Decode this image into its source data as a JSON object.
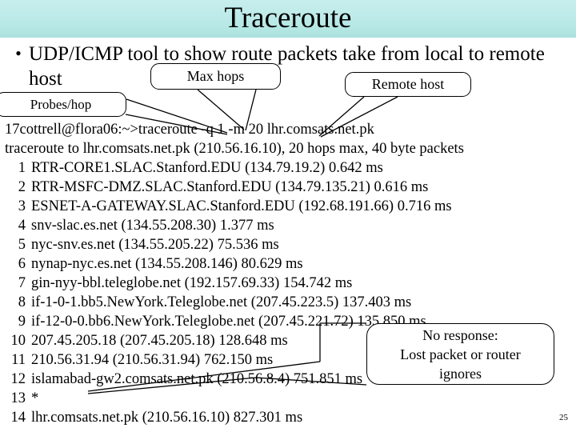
{
  "slide": {
    "title": "Traceroute",
    "page_number": "25",
    "band_color": "#bdebe9",
    "background_color": "#ffffff",
    "text_color": "#000000"
  },
  "bullet": {
    "marker": "•",
    "text": "UDP/ICMP tool to show route packets take from local to remote host"
  },
  "callouts": [
    {
      "name": "max-hops",
      "label": "Max hops"
    },
    {
      "name": "remote-host",
      "label": "Remote host"
    },
    {
      "name": "probes-per-hop",
      "label": "Probes/hop"
    },
    {
      "name": "no-response",
      "line1": "No response:",
      "line2": "Lost packet or router",
      "line3": "ignores"
    }
  ],
  "transcript": {
    "prompt_line": "17cottrell@flora06:~>traceroute -q 1 -m 20 lhr.comsats.net.pk",
    "header_line": "traceroute to lhr.comsats.net.pk (210.56.16.10), 20 hops max, 40 byte packets",
    "hops": [
      {
        "num": "1",
        "text": "RTR-CORE1.SLAC.Stanford.EDU (134.79.19.2)  0.642 ms"
      },
      {
        "num": "2",
        "text": "RTR-MSFC-DMZ.SLAC.Stanford.EDU (134.79.135.21)  0.616 ms"
      },
      {
        "num": "3",
        "text": "ESNET-A-GATEWAY.SLAC.Stanford.EDU (192.68.191.66)  0.716 ms"
      },
      {
        "num": "4",
        "text": "snv-slac.es.net (134.55.208.30)  1.377 ms"
      },
      {
        "num": "5",
        "text": "nyc-snv.es.net (134.55.205.22)  75.536 ms"
      },
      {
        "num": "6",
        "text": "nynap-nyc.es.net (134.55.208.146)  80.629 ms"
      },
      {
        "num": "7",
        "text": "gin-nyy-bbl.teleglobe.net (192.157.69.33)  154.742 ms"
      },
      {
        "num": "8",
        "text": "if-1-0-1.bb5.NewYork.Teleglobe.net (207.45.223.5)  137.403 ms"
      },
      {
        "num": "9",
        "text": "if-12-0-0.bb6.NewYork.Teleglobe.net (207.45.221.72)  135.850 ms"
      },
      {
        "num": "10",
        "text": "207.45.205.18 (207.45.205.18)  128.648 ms"
      },
      {
        "num": "11",
        "text": "210.56.31.94 (210.56.31.94)  762.150 ms"
      },
      {
        "num": "12",
        "text": "islamabad-gw2.comsats.net.pk (210.56.8.4)  751.851 ms"
      },
      {
        "num": "13",
        "text": "*"
      },
      {
        "num": "14",
        "text": "lhr.comsats.net.pk (210.56.16.10)  827.301 ms"
      }
    ]
  }
}
